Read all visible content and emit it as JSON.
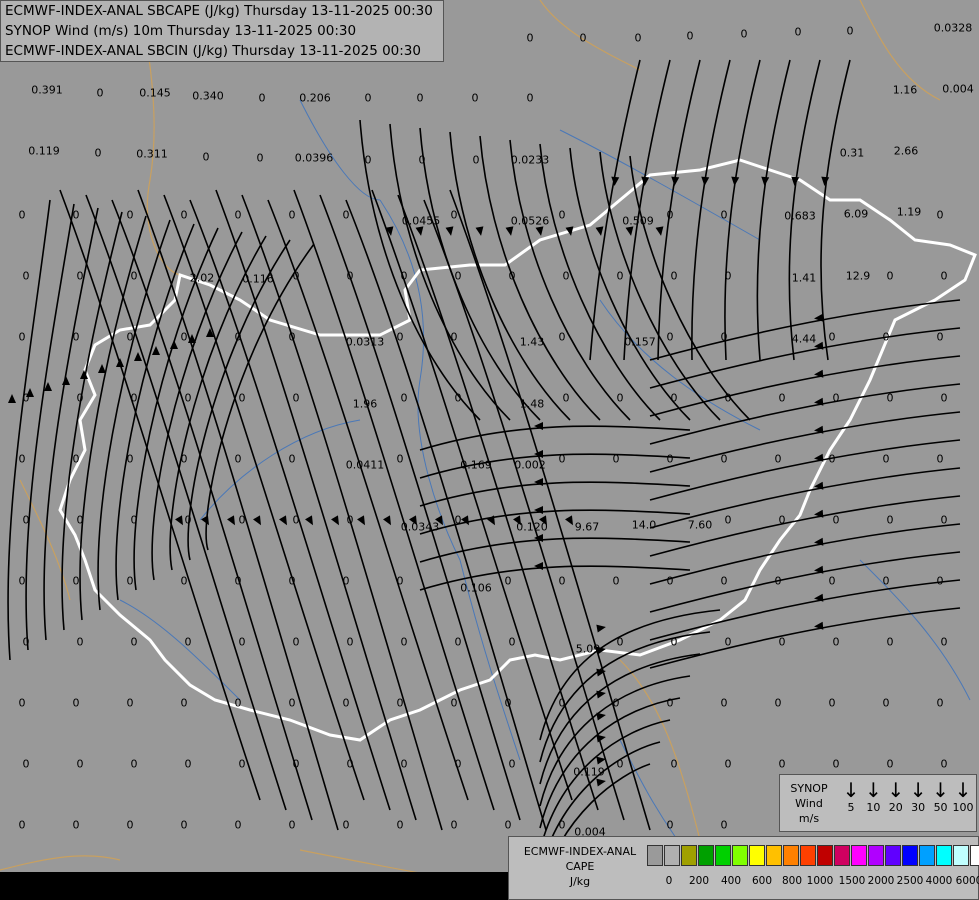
{
  "titles": {
    "line1": "ECMWF-INDEX-ANAL SBCAPE (J/kg) Thursday 13-11-2025 00:30",
    "line2": "SYNOP Wind (m/s) 10m Thursday 13-11-2025 00:30",
    "line3": "ECMWF-INDEX-ANAL SBCIN (J/kg) Thursday 13-11-2025 00:30"
  },
  "colors": {
    "background": "#999999",
    "border": "#ffffff",
    "river": "#4a78b8",
    "region_line": "#c8a060",
    "streamline": "#000000"
  },
  "map_values": [
    {
      "t": "0.391"
    },
    {
      "t": "0"
    },
    {
      "t": "0.145"
    },
    {
      "t": "0.340"
    },
    {
      "t": "0"
    },
    {
      "t": "0.206"
    },
    {
      "t": "0"
    },
    {
      "t": "0"
    },
    {
      "t": "0"
    },
    {
      "t": "0"
    },
    {
      "t": "0.119"
    },
    {
      "t": "0"
    },
    {
      "t": "0.311"
    },
    {
      "t": "0"
    },
    {
      "t": "0"
    },
    {
      "t": "0.0396"
    },
    {
      "t": "0"
    },
    {
      "t": "0"
    },
    {
      "t": "0"
    },
    {
      "t": "0.0233"
    },
    {
      "t": "0.0455"
    },
    {
      "t": "0.0526"
    },
    {
      "t": "0.509"
    },
    {
      "t": "0.683"
    },
    {
      "t": "6.09"
    },
    {
      "t": "1.19"
    },
    {
      "t": "2.02"
    },
    {
      "t": "0.116"
    },
    {
      "t": "1.41"
    },
    {
      "t": "12.9"
    },
    {
      "t": "0.0313"
    },
    {
      "t": "1.43"
    },
    {
      "t": "0.157"
    },
    {
      "t": "4.44"
    },
    {
      "t": "1.96"
    },
    {
      "t": "1.48"
    },
    {
      "t": "0.0411"
    },
    {
      "t": "0.169"
    },
    {
      "t": "0.002"
    },
    {
      "t": "0.0343"
    },
    {
      "t": "0.120"
    },
    {
      "t": "9.67"
    },
    {
      "t": "14.0"
    },
    {
      "t": "7.60"
    },
    {
      "t": "0.106"
    },
    {
      "t": "5.09"
    },
    {
      "t": "0.119"
    },
    {
      "t": "0.004"
    },
    {
      "t": "0.0328"
    },
    {
      "t": "1.16"
    },
    {
      "t": "0.004"
    },
    {
      "t": "2.66"
    },
    {
      "t": "0.31"
    },
    {
      "t": "0"
    },
    {
      "t": "0"
    },
    {
      "t": "0"
    },
    {
      "t": "0"
    },
    {
      "t": "0"
    },
    {
      "t": "0"
    },
    {
      "t": "0"
    }
  ],
  "synop_legend": {
    "label_lines": [
      "SYNOP",
      "Wind",
      "m/s"
    ],
    "arrows": [
      {
        "glyph": "↓",
        "speed": "5"
      },
      {
        "glyph": "↓",
        "speed": "10"
      },
      {
        "glyph": "↓",
        "speed": "20"
      },
      {
        "glyph": "↓",
        "speed": "30"
      },
      {
        "glyph": "↓",
        "speed": "50"
      },
      {
        "glyph": "↓",
        "speed": "100"
      }
    ]
  },
  "cape_legend": {
    "label_lines": [
      "ECMWF-INDEX-ANAL",
      "CAPE",
      "J/kg"
    ],
    "swatch_colors": [
      "#9a9a9a",
      "#b0b0b0",
      "#a0a000",
      "#00a000",
      "#00d000",
      "#80ff00",
      "#ffff00",
      "#ffc000",
      "#ff8000",
      "#ff4000",
      "#c00000",
      "#d00060",
      "#ff00ff",
      "#b000ff",
      "#6000ff",
      "#0000ff",
      "#00a0ff",
      "#00ffff",
      "#c0ffff",
      "#ffffff"
    ],
    "ticks": [
      "0",
      "200",
      "400",
      "600",
      "800",
      "1000",
      "1500",
      "2000",
      "2500",
      "4000",
      "6000"
    ]
  }
}
